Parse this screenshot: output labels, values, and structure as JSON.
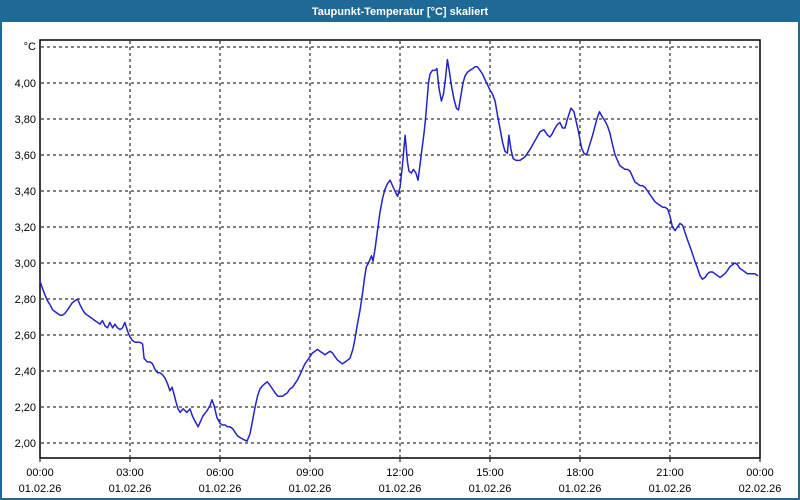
{
  "window": {
    "title": "Taupunkt-Temperatur [°C] skaliert"
  },
  "colors": {
    "titlebar_bg": "#1E6996",
    "window_border": "#1E6996",
    "plot_bg": "#FFFFFF",
    "grid": "#000000",
    "axis": "#000000",
    "text": "#000000",
    "line": "#2323C8"
  },
  "chart_data": {
    "type": "line",
    "title": "Taupunkt-Temperatur [°C] skaliert",
    "unit_label": "°C",
    "xlabel": "",
    "ylabel": "",
    "grid": "dashed",
    "legend": "none",
    "ylim": [
      2.0,
      4.2
    ],
    "xlim_hours": [
      0,
      24
    ],
    "y_gridline_values": [
      4.2,
      4.0,
      3.8,
      3.6,
      3.4,
      3.2,
      3.0,
      2.8,
      2.6,
      2.4,
      2.2,
      2.0
    ],
    "y_ticks": [
      {
        "label": "4,00",
        "value": 4.0
      },
      {
        "label": "3,80",
        "value": 3.8
      },
      {
        "label": "3,60",
        "value": 3.6
      },
      {
        "label": "3,40",
        "value": 3.4
      },
      {
        "label": "3,20",
        "value": 3.2
      },
      {
        "label": "3,00",
        "value": 3.0
      },
      {
        "label": "2,80",
        "value": 2.8
      },
      {
        "label": "2,60",
        "value": 2.6
      },
      {
        "label": "2,40",
        "value": 2.4
      },
      {
        "label": "2,20",
        "value": 2.2
      },
      {
        "label": "2,00",
        "value": 2.0
      }
    ],
    "x_ticks": [
      {
        "hour": 0,
        "time": "00:00",
        "date": "01.02.26"
      },
      {
        "hour": 3,
        "time": "03:00",
        "date": "01.02.26"
      },
      {
        "hour": 6,
        "time": "06:00",
        "date": "01.02.26"
      },
      {
        "hour": 9,
        "time": "09:00",
        "date": "01.02.26"
      },
      {
        "hour": 12,
        "time": "12:00",
        "date": "01.02.26"
      },
      {
        "hour": 15,
        "time": "15:00",
        "date": "01.02.26"
      },
      {
        "hour": 18,
        "time": "18:00",
        "date": "01.02.26"
      },
      {
        "hour": 21,
        "time": "21:00",
        "date": "01.02.26"
      },
      {
        "hour": 24,
        "time": "00:00",
        "date": "02.02.26"
      }
    ],
    "series": [
      {
        "name": "Taupunkt-Temperatur",
        "points": [
          [
            0,
            2.9
          ],
          [
            0.08,
            2.86
          ],
          [
            0.17,
            2.82
          ],
          [
            0.25,
            2.79
          ],
          [
            0.33,
            2.77
          ],
          [
            0.42,
            2.74
          ],
          [
            0.5,
            2.73
          ],
          [
            0.58,
            2.72
          ],
          [
            0.67,
            2.71
          ],
          [
            0.75,
            2.71
          ],
          [
            0.83,
            2.72
          ],
          [
            0.92,
            2.74
          ],
          [
            1,
            2.76
          ],
          [
            1.08,
            2.78
          ],
          [
            1.17,
            2.79
          ],
          [
            1.25,
            2.8
          ],
          [
            1.33,
            2.77
          ],
          [
            1.42,
            2.74
          ],
          [
            1.5,
            2.72
          ],
          [
            1.58,
            2.71
          ],
          [
            1.67,
            2.7
          ],
          [
            1.75,
            2.69
          ],
          [
            1.83,
            2.68
          ],
          [
            1.92,
            2.67
          ],
          [
            2,
            2.66
          ],
          [
            2.08,
            2.68
          ],
          [
            2.17,
            2.65
          ],
          [
            2.25,
            2.64
          ],
          [
            2.33,
            2.67
          ],
          [
            2.42,
            2.64
          ],
          [
            2.5,
            2.66
          ],
          [
            2.58,
            2.64
          ],
          [
            2.67,
            2.63
          ],
          [
            2.75,
            2.64
          ],
          [
            2.83,
            2.67
          ],
          [
            2.92,
            2.62
          ],
          [
            3,
            2.59
          ],
          [
            3.08,
            2.57
          ],
          [
            3.17,
            2.56
          ],
          [
            3.33,
            2.56
          ],
          [
            3.42,
            2.55
          ],
          [
            3.47,
            2.47
          ],
          [
            3.58,
            2.45
          ],
          [
            3.67,
            2.45
          ],
          [
            3.75,
            2.44
          ],
          [
            3.83,
            2.41
          ],
          [
            3.92,
            2.39
          ],
          [
            4,
            2.39
          ],
          [
            4.08,
            2.38
          ],
          [
            4.17,
            2.36
          ],
          [
            4.25,
            2.33
          ],
          [
            4.33,
            2.29
          ],
          [
            4.4,
            2.31
          ],
          [
            4.47,
            2.27
          ],
          [
            4.53,
            2.23
          ],
          [
            4.6,
            2.19
          ],
          [
            4.67,
            2.17
          ],
          [
            4.77,
            2.19
          ],
          [
            4.83,
            2.18
          ],
          [
            4.9,
            2.17
          ],
          [
            5,
            2.19
          ],
          [
            5.08,
            2.15
          ],
          [
            5.17,
            2.12
          ],
          [
            5.27,
            2.09
          ],
          [
            5.35,
            2.12
          ],
          [
            5.43,
            2.15
          ],
          [
            5.57,
            2.18
          ],
          [
            5.67,
            2.21
          ],
          [
            5.73,
            2.24
          ],
          [
            5.8,
            2.21
          ],
          [
            5.9,
            2.14
          ],
          [
            6,
            2.11
          ],
          [
            6.08,
            2.1
          ],
          [
            6.17,
            2.1
          ],
          [
            6.25,
            2.09
          ],
          [
            6.33,
            2.09
          ],
          [
            6.42,
            2.08
          ],
          [
            6.5,
            2.06
          ],
          [
            6.58,
            2.04
          ],
          [
            6.67,
            2.03
          ],
          [
            6.78,
            2.02
          ],
          [
            6.9,
            2.01
          ],
          [
            7,
            2.05
          ],
          [
            7.08,
            2.12
          ],
          [
            7.17,
            2.2
          ],
          [
            7.25,
            2.26
          ],
          [
            7.33,
            2.3
          ],
          [
            7.43,
            2.32
          ],
          [
            7.5,
            2.33
          ],
          [
            7.58,
            2.34
          ],
          [
            7.67,
            2.32
          ],
          [
            7.75,
            2.3
          ],
          [
            7.83,
            2.28
          ],
          [
            7.93,
            2.26
          ],
          [
            8,
            2.26
          ],
          [
            8.08,
            2.26
          ],
          [
            8.17,
            2.27
          ],
          [
            8.25,
            2.28
          ],
          [
            8.33,
            2.3
          ],
          [
            8.42,
            2.31
          ],
          [
            8.5,
            2.33
          ],
          [
            8.58,
            2.35
          ],
          [
            8.67,
            2.38
          ],
          [
            8.75,
            2.41
          ],
          [
            8.83,
            2.44
          ],
          [
            8.92,
            2.46
          ],
          [
            9,
            2.48
          ],
          [
            9.08,
            2.5
          ],
          [
            9.17,
            2.51
          ],
          [
            9.25,
            2.52
          ],
          [
            9.33,
            2.51
          ],
          [
            9.42,
            2.5
          ],
          [
            9.5,
            2.49
          ],
          [
            9.58,
            2.5
          ],
          [
            9.67,
            2.51
          ],
          [
            9.75,
            2.5
          ],
          [
            9.83,
            2.48
          ],
          [
            9.92,
            2.46
          ],
          [
            10,
            2.45
          ],
          [
            10.08,
            2.44
          ],
          [
            10.17,
            2.45
          ],
          [
            10.25,
            2.46
          ],
          [
            10.33,
            2.47
          ],
          [
            10.43,
            2.52
          ],
          [
            10.5,
            2.58
          ],
          [
            10.58,
            2.66
          ],
          [
            10.67,
            2.74
          ],
          [
            10.75,
            2.83
          ],
          [
            10.82,
            2.92
          ],
          [
            10.88,
            2.98
          ],
          [
            10.95,
            3.0
          ],
          [
            11,
            3.02
          ],
          [
            11.05,
            3.04
          ],
          [
            11.1,
            3.01
          ],
          [
            11.17,
            3.08
          ],
          [
            11.25,
            3.18
          ],
          [
            11.33,
            3.28
          ],
          [
            11.42,
            3.36
          ],
          [
            11.5,
            3.41
          ],
          [
            11.58,
            3.44
          ],
          [
            11.67,
            3.46
          ],
          [
            11.75,
            3.43
          ],
          [
            11.83,
            3.4
          ],
          [
            11.92,
            3.37
          ],
          [
            12,
            3.42
          ],
          [
            12.08,
            3.54
          ],
          [
            12.17,
            3.71
          ],
          [
            12.25,
            3.56
          ],
          [
            12.3,
            3.51
          ],
          [
            12.38,
            3.5
          ],
          [
            12.45,
            3.52
          ],
          [
            12.53,
            3.5
          ],
          [
            12.6,
            3.46
          ],
          [
            12.67,
            3.55
          ],
          [
            12.73,
            3.63
          ],
          [
            12.8,
            3.72
          ],
          [
            12.85,
            3.8
          ],
          [
            12.9,
            3.9
          ],
          [
            12.95,
            4.0
          ],
          [
            13,
            4.05
          ],
          [
            13.08,
            4.07
          ],
          [
            13.17,
            4.07
          ],
          [
            13.23,
            4.08
          ],
          [
            13.3,
            3.97
          ],
          [
            13.38,
            3.9
          ],
          [
            13.45,
            3.94
          ],
          [
            13.52,
            4.03
          ],
          [
            13.58,
            4.13
          ],
          [
            13.65,
            4.06
          ],
          [
            13.72,
            3.98
          ],
          [
            13.8,
            3.91
          ],
          [
            13.88,
            3.86
          ],
          [
            13.95,
            3.85
          ],
          [
            14.03,
            3.93
          ],
          [
            14.1,
            4.0
          ],
          [
            14.17,
            4.04
          ],
          [
            14.25,
            4.06
          ],
          [
            14.33,
            4.07
          ],
          [
            14.42,
            4.08
          ],
          [
            14.5,
            4.09
          ],
          [
            14.58,
            4.09
          ],
          [
            14.67,
            4.07
          ],
          [
            14.75,
            4.05
          ],
          [
            14.83,
            4.02
          ],
          [
            14.92,
            3.99
          ],
          [
            15,
            3.96
          ],
          [
            15.08,
            3.94
          ],
          [
            15.17,
            3.9
          ],
          [
            15.25,
            3.82
          ],
          [
            15.33,
            3.75
          ],
          [
            15.42,
            3.67
          ],
          [
            15.5,
            3.62
          ],
          [
            15.58,
            3.61
          ],
          [
            15.63,
            3.71
          ],
          [
            15.7,
            3.63
          ],
          [
            15.77,
            3.58
          ],
          [
            15.87,
            3.57
          ],
          [
            16,
            3.57
          ],
          [
            16.17,
            3.59
          ],
          [
            16.33,
            3.63
          ],
          [
            16.5,
            3.68
          ],
          [
            16.67,
            3.73
          ],
          [
            16.8,
            3.74
          ],
          [
            16.92,
            3.71
          ],
          [
            17,
            3.7
          ],
          [
            17.08,
            3.72
          ],
          [
            17.17,
            3.75
          ],
          [
            17.25,
            3.77
          ],
          [
            17.33,
            3.78
          ],
          [
            17.42,
            3.75
          ],
          [
            17.5,
            3.75
          ],
          [
            17.58,
            3.8
          ],
          [
            17.7,
            3.86
          ],
          [
            17.8,
            3.84
          ],
          [
            17.88,
            3.78
          ],
          [
            17.95,
            3.73
          ],
          [
            18.05,
            3.64
          ],
          [
            18.13,
            3.61
          ],
          [
            18.22,
            3.6
          ],
          [
            18.33,
            3.66
          ],
          [
            18.42,
            3.71
          ],
          [
            18.5,
            3.76
          ],
          [
            18.58,
            3.81
          ],
          [
            18.65,
            3.84
          ],
          [
            18.75,
            3.81
          ],
          [
            18.83,
            3.79
          ],
          [
            18.92,
            3.76
          ],
          [
            19,
            3.72
          ],
          [
            19.08,
            3.66
          ],
          [
            19.17,
            3.6
          ],
          [
            19.25,
            3.57
          ],
          [
            19.33,
            3.54
          ],
          [
            19.42,
            3.53
          ],
          [
            19.5,
            3.52
          ],
          [
            19.58,
            3.52
          ],
          [
            19.67,
            3.51
          ],
          [
            19.75,
            3.48
          ],
          [
            19.83,
            3.45
          ],
          [
            19.92,
            3.44
          ],
          [
            20,
            3.43
          ],
          [
            20.08,
            3.43
          ],
          [
            20.17,
            3.42
          ],
          [
            20.25,
            3.4
          ],
          [
            20.33,
            3.38
          ],
          [
            20.42,
            3.36
          ],
          [
            20.5,
            3.34
          ],
          [
            20.58,
            3.33
          ],
          [
            20.67,
            3.32
          ],
          [
            20.75,
            3.31
          ],
          [
            20.83,
            3.31
          ],
          [
            20.92,
            3.3
          ],
          [
            21,
            3.26
          ],
          [
            21.08,
            3.2
          ],
          [
            21.17,
            3.18
          ],
          [
            21.25,
            3.2
          ],
          [
            21.33,
            3.22
          ],
          [
            21.42,
            3.21
          ],
          [
            21.5,
            3.17
          ],
          [
            21.58,
            3.13
          ],
          [
            21.67,
            3.09
          ],
          [
            21.75,
            3.05
          ],
          [
            21.83,
            3.01
          ],
          [
            21.92,
            2.97
          ],
          [
            22,
            2.93
          ],
          [
            22.08,
            2.91
          ],
          [
            22.17,
            2.92
          ],
          [
            22.25,
            2.94
          ],
          [
            22.33,
            2.95
          ],
          [
            22.42,
            2.95
          ],
          [
            22.5,
            2.94
          ],
          [
            22.58,
            2.93
          ],
          [
            22.67,
            2.92
          ],
          [
            22.75,
            2.93
          ],
          [
            22.83,
            2.94
          ],
          [
            22.92,
            2.96
          ],
          [
            23,
            2.98
          ],
          [
            23.08,
            2.99
          ],
          [
            23.17,
            3.0
          ],
          [
            23.25,
            2.99
          ],
          [
            23.33,
            2.97
          ],
          [
            23.42,
            2.96
          ],
          [
            23.5,
            2.95
          ],
          [
            23.58,
            2.94
          ],
          [
            23.67,
            2.94
          ],
          [
            23.75,
            2.94
          ],
          [
            23.83,
            2.94
          ],
          [
            23.92,
            2.93
          ]
        ]
      }
    ]
  }
}
